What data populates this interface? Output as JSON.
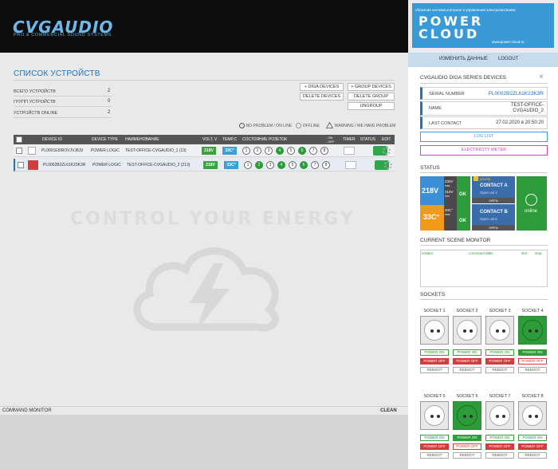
{
  "header": {
    "logo": "CVGAUDIO",
    "logo_sub": "PRO & COMMERCIAL SOUND SYSTEMS"
  },
  "powercloud": {
    "tagline": "облачная система контроля и управления электропитанием",
    "name_1": "POWER",
    "name_2": "CLOUD",
    "url": "www.power-cloud.ru"
  },
  "userbar": {
    "change": "ИЗМЕНИТЬ ДАННЫЕ",
    "logout": "LOGOUT"
  },
  "devices": {
    "title": "СПИСОК УСТРОЙСТВ",
    "stats": [
      {
        "label": "ВСЕГО УСТРОЙСТВ",
        "value": "2"
      },
      {
        "label": "ГРУПП УСТРОЙСТВ",
        "value": "0"
      },
      {
        "label": "УСТРОЙСТВ ONLINE",
        "value": "2"
      }
    ],
    "buttons": {
      "diga": "+ DIGA DEVICES",
      "group": "+ GROUP DEVICES",
      "delete_devices": "DELETE DEVICES",
      "delete_group": "DELETE GROUP",
      "ungroup": "UNGROUP"
    },
    "legend": {
      "ok": "NO PROBLEM / ON LINE",
      "offline": "OFFLINE",
      "warning": "WARNING / WE HAVE PROBLEM"
    },
    "columns": [
      "DEVICE ID",
      "DEVICE TYPE",
      "НАИМЕНОВАНИЕ",
      "VOLT, V",
      "TEMP,C",
      "СОСТОЯНИЕ РОЗЕТОК",
      "TIMER",
      "STATUS",
      "EDIT"
    ],
    "onoff": {
      "on": "- ON",
      "off": "- OFF"
    },
    "rows": [
      {
        "id": "PL0001E5IROVJVJ8J9",
        "type": "POWER LOGIC",
        "name": "TEST-OFFICE-CVGAUDIO_1 (13)",
        "volt": "218V",
        "temp": "33C°",
        "sockets": [
          "1",
          "2",
          "3",
          "4",
          "5",
          "6",
          "7",
          "8"
        ],
        "on": [
          true,
          false,
          false,
          true,
          false,
          true,
          false,
          false
        ]
      },
      {
        "id": "PL0002B2ZL61K23K3R",
        "type": "POWER LOGIC",
        "name": "TEST-OFFICE-CVGAUDIO_2 (213)",
        "volt": "218V",
        "temp": "33C°",
        "sockets": [
          "1",
          "2",
          "3",
          "4",
          "5",
          "6",
          "7",
          "8"
        ],
        "on": [
          false,
          true,
          false,
          true,
          false,
          true,
          false,
          false
        ]
      }
    ]
  },
  "watermark": "CONTROL YOUR ENERGY",
  "command_monitor": {
    "label": "COMMAND MONITOR",
    "clean": "CLEAN"
  },
  "panel": {
    "title": "CVGAUDIO DIGA SERIES DEVICES",
    "close": "×",
    "serial_label": "SERIAL NUMBER",
    "serial": "PL0002B2ZL61K23K3R",
    "name_label": "NAME",
    "name_1": "TEST-OFFICE-",
    "name_2": "CVGAUDIO_2",
    "contact_label": "LAST CONTACT",
    "contact": "27.02.2020 в 20:50:20",
    "log_btn": "LOG LIST",
    "meter_btn": "ELECTRICITY METER",
    "status_title": "STATUS",
    "status": {
      "volt": "218V",
      "volt_max": "230V",
      "volt_max_lbl": "max",
      "volt_min": "210V",
      "volt_min_lbl": "min",
      "volt_ok": "OK",
      "temp": "33C°",
      "temp_max": "40C°",
      "temp_max_lbl": "max",
      "temp_ok": "OK",
      "priority": "priority",
      "contact_a": "CONTACT A",
      "contact_a_sub": "Open usl 4",
      "contact_a_state": "OPEN",
      "contact_b": "CONTACT B",
      "contact_b_sub": "Open usl 5",
      "contact_b_state": "OPEN",
      "online": "online"
    },
    "scene_title": "CURRENT SCENE MONITOR",
    "scene_cols": [
      "initiator",
      "command table",
      "slot",
      "stop"
    ],
    "sockets_title": "SOCKETS",
    "power_on": "POWER ON",
    "power_off": "POWER OFF",
    "reboot": "REBOOT",
    "sockets": [
      {
        "label": "SOCKET 1",
        "on": false
      },
      {
        "label": "SOCKET 2",
        "on": false
      },
      {
        "label": "SOCKET 3",
        "on": false
      },
      {
        "label": "SOCKET 4",
        "on": true
      },
      {
        "label": "SOCKET 5",
        "on": false
      },
      {
        "label": "SOCKET 6",
        "on": true
      },
      {
        "label": "SOCKET 7",
        "on": false
      },
      {
        "label": "SOCKET 8",
        "on": false
      }
    ]
  },
  "colors": {
    "accent": "#1e73be",
    "green": "#2e9b3a",
    "red": "#d43b3b",
    "blue": "#3aa0d8",
    "orange": "#f39a1a",
    "magenta": "#d641c9"
  }
}
